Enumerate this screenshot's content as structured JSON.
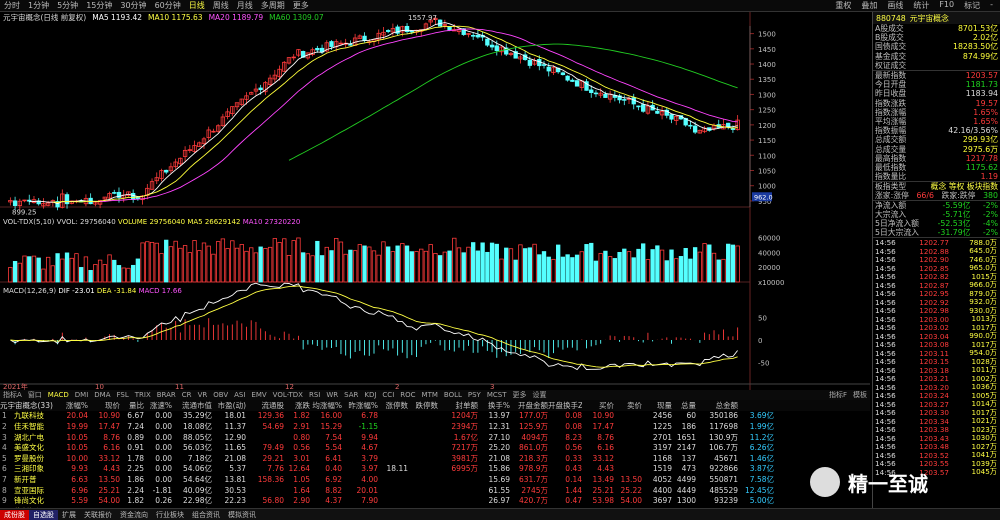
{
  "top_tabs": [
    "分时",
    "1分钟",
    "5分钟",
    "15分钟",
    "30分钟",
    "60分钟",
    "日线",
    "周线",
    "月线",
    "多周期",
    "更多"
  ],
  "top_tabs_active": 6,
  "top_right": [
    "重权",
    "叠加",
    "画线",
    "统计",
    "F10",
    "标记",
    "-"
  ],
  "title": {
    "name": "元宇宙概念(日线 前复权)",
    "ma5": "MA5 1193.42",
    "ma10": "MA10 1175.63",
    "ma20": "MA20 1189.79",
    "ma60": "MA60 1309.07"
  },
  "price_axis": [
    "1500",
    "1450",
    "1400",
    "1350",
    "1300",
    "1250",
    "1200",
    "1150",
    "1100",
    "1050",
    "1000",
    "950"
  ],
  "hi_label": "1557.97",
  "lo_label": "899.25",
  "cur_label": "962.0",
  "vol_title": {
    "name": "VOL-TDX(5,10)",
    "vvol": "VVOL: 29756040",
    "volume": "VOLUME 29756040",
    "ma5": "MA5 26629142",
    "ma10": "MA10 27320220"
  },
  "vol_axis": [
    "60000",
    "40000",
    "20000",
    "x10000"
  ],
  "macd_title": {
    "name": "MACD(12,26,9)",
    "dif": "DIF -23.01",
    "dea": "DEA -31.84",
    "macd": "MACD 17.66"
  },
  "macd_axis": [
    "50",
    "0",
    "-50"
  ],
  "date_axis": [
    "2021年",
    "10",
    "11",
    "12",
    "2",
    "3"
  ],
  "ind_tabs": [
    "指标A",
    "窗口",
    "MACD",
    "DMI",
    "DMA",
    "FSL",
    "TRIX",
    "BRAR",
    "CR",
    "VR",
    "OBV",
    "ASI",
    "EMV",
    "VOL-TDX",
    "RSI",
    "WR",
    "SAR",
    "KDJ",
    "CCI",
    "ROC",
    "MTM",
    "BOLL",
    "PSY",
    "MCST",
    "更多",
    "设置"
  ],
  "ind_active": 2,
  "ind_right": [
    "指标F",
    "模板"
  ],
  "table": {
    "title": "元宇宙概念(33)",
    "headers": [
      "",
      "涨幅%",
      "现价",
      "量比",
      "涨速%",
      "流通市值",
      "市盈(动)",
      "流通股",
      "涨跌",
      "均涨幅%",
      "昨涨幅%",
      "涨停数",
      "跌停数",
      "封单额",
      "换手%",
      "开盘金额",
      "开盘换手Z",
      "买价",
      "卖价",
      "现量",
      "总量",
      "总金额"
    ],
    "rows": [
      [
        "1",
        "九联科技",
        "20.04",
        "10.90",
        "6.67",
        "0.00",
        "35.29亿",
        "18.01",
        "129.36",
        "1.82",
        "16.00",
        "6.78",
        "",
        "",
        "1204万",
        "13.97",
        "177.0万",
        "0.08",
        "10.90",
        "",
        "2456",
        "60",
        "350186",
        "3.69亿"
      ],
      [
        "2",
        "佳禾智能",
        "19.99",
        "17.47",
        "7.24",
        "0.00",
        "18.08亿",
        "11.37",
        "54.69",
        "2.91",
        "15.29",
        "-1.15",
        "",
        "",
        "2394万",
        "12.31",
        "125.9万",
        "0.08",
        "17.47",
        "",
        "1225",
        "186",
        "117698",
        "1.99亿"
      ],
      [
        "3",
        "湖北广电",
        "10.05",
        "8.76",
        "0.89",
        "0.00",
        "88.05亿",
        "12.90",
        "",
        "0.80",
        "7.54",
        "9.94",
        "",
        "",
        "1.67亿",
        "27.10",
        "4094万",
        "8.23",
        "8.76",
        "",
        "2701",
        "1651",
        "130.9万",
        "11.2亿"
      ],
      [
        "4",
        "美盛文化",
        "10.05",
        "6.16",
        "0.91",
        "0.00",
        "56.03亿",
        "11.65",
        "79.49",
        "0.56",
        "5.54",
        "4.67",
        "",
        "",
        "7217万",
        "25.20",
        "861.0万",
        "0.56",
        "6.16",
        "",
        "3197",
        "2147",
        "106.7万",
        "6.26亿"
      ],
      [
        "5",
        "罗曼股份",
        "10.00",
        "33.12",
        "1.78",
        "0.00",
        "7.18亿",
        "21.08",
        "29.21",
        "3.01",
        "6.41",
        "3.79",
        "",
        "",
        "3981万",
        "21.08",
        "218.3万",
        "0.33",
        "33.12",
        "",
        "1168",
        "137",
        "45671",
        "1.46亿"
      ],
      [
        "6",
        "三湘印象",
        "9.93",
        "4.43",
        "2.25",
        "0.00",
        "54.06亿",
        "5.37",
        "7.76",
        "12.64",
        "0.40",
        "3.97",
        "18.11",
        "",
        "6995万",
        "15.86",
        "978.9万",
        "0.43",
        "4.43",
        "",
        "1519",
        "473",
        "922866",
        "3.87亿"
      ],
      [
        "7",
        "新开普",
        "6.63",
        "13.50",
        "1.86",
        "0.00",
        "54.64亿",
        "13.81",
        "158.36",
        "1.05",
        "6.92",
        "4.00",
        "",
        "",
        "",
        "15.69",
        "631.7万",
        "0.14",
        "13.49",
        "13.50",
        "4052",
        "4499",
        "550871",
        "7.58亿"
      ],
      [
        "8",
        "宣亚国际",
        "6.96",
        "25.21",
        "2.24",
        "-1.81",
        "40.09亿",
        "30.53",
        "",
        "1.64",
        "8.82",
        "20.01",
        "",
        "",
        "",
        "61.55",
        "2745万",
        "1.44",
        "25.21",
        "25.22",
        "4400",
        "4449",
        "485529",
        "12.45亿"
      ],
      [
        "9",
        "锋尚文化",
        "5.59",
        "54.00",
        "1.82",
        "0.26",
        "22.98亿",
        "22.23",
        "56.80",
        "2.90",
        "4.37",
        "7.90",
        "",
        "",
        "",
        "26.97",
        "420.7万",
        "0.47",
        "53.98",
        "54.00",
        "3697",
        "1300",
        "93239",
        "5.00亿"
      ],
      [
        "10",
        "佳创视讯",
        "4.70",
        "8.11",
        "1.53",
        "0.50",
        "27.38亿",
        "14.27",
        "",
        "0.37",
        "4.39",
        "2.79",
        "",
        "",
        "",
        "15.20",
        "166.9万",
        "0.07",
        "8.11",
        "8.12",
        "3679",
        "5733",
        "481675",
        "3.89亿"
      ]
    ]
  },
  "bottom_tabs": [
    "成份股",
    "自选股",
    "扩展",
    "关联报价",
    "资金流向",
    "行业板块",
    "组合资讯",
    "模拟资讯"
  ],
  "side": {
    "code": "880748",
    "name": "元宇宙概念",
    "top_kv": [
      [
        "A股成交",
        "8701.53亿"
      ],
      [
        "B股成交",
        "2.02亿"
      ],
      [
        "国债成交",
        "18283.50亿"
      ],
      [
        "基金成交",
        "874.99亿"
      ],
      [
        "权证成交",
        ""
      ]
    ],
    "mid_kv": [
      [
        "最新指数",
        "1203.57",
        "red"
      ],
      [
        "今日开盘",
        "1181.73",
        "grn"
      ],
      [
        "昨日收盘",
        "1183.94",
        "wht"
      ],
      [
        "指数涨跌",
        "19.57",
        "red"
      ],
      [
        "指数涨幅",
        "1.65%",
        "red"
      ],
      [
        "平均涨幅",
        "1.65%",
        "red"
      ],
      [
        "指数振幅",
        "42.16/3.56%",
        "wht"
      ],
      [
        "总成交额",
        "299.93亿",
        "yel"
      ],
      [
        "总成交量",
        "2975.6万",
        "yel"
      ],
      [
        "最高指数",
        "1217.78",
        "red"
      ],
      [
        "最低指数",
        "1175.62",
        "grn"
      ],
      [
        "指数量比",
        "1.19",
        "red"
      ]
    ],
    "type_row": [
      "板指类型",
      "概念 等权 板块指数"
    ],
    "updown_row": [
      "涨家:涨停",
      "66/6",
      "跌家:跌停",
      "380"
    ],
    "flow_kv": [
      [
        "净流入额",
        "-5.59亿",
        "-2%"
      ],
      [
        "大宗流入",
        "-5.71亿",
        "-2%"
      ],
      [
        "5日净流入额",
        "-52.53亿",
        "-4%"
      ],
      [
        "5日大宗流入",
        "-31.79亿",
        "-2%"
      ]
    ],
    "ticks": [
      [
        "14:56",
        "1202.77",
        "788.0万"
      ],
      [
        "14:56",
        "1202.88",
        "645.0万"
      ],
      [
        "14:56",
        "1202.90",
        "746.0万"
      ],
      [
        "14:56",
        "1202.85",
        "965.0万"
      ],
      [
        "14:56",
        "1202.82",
        "1015万"
      ],
      [
        "14:56",
        "1202.87",
        "966.0万"
      ],
      [
        "14:56",
        "1202.95",
        "879.0万"
      ],
      [
        "14:56",
        "1202.92",
        "932.0万"
      ],
      [
        "14:56",
        "1202.98",
        "930.0万"
      ],
      [
        "14:56",
        "1203.00",
        "1013万"
      ],
      [
        "14:56",
        "1203.02",
        "1017万"
      ],
      [
        "14:56",
        "1203.04",
        "990.0万"
      ],
      [
        "14:56",
        "1203.08",
        "1017万"
      ],
      [
        "14:56",
        "1203.11",
        "954.0万"
      ],
      [
        "14:56",
        "1203.15",
        "1028万"
      ],
      [
        "14:56",
        "1203.18",
        "1011万"
      ],
      [
        "14:56",
        "1203.21",
        "1002万"
      ],
      [
        "14:56",
        "1203.20",
        "1036万"
      ],
      [
        "14:56",
        "1203.24",
        "1005万"
      ],
      [
        "14:56",
        "1203.27",
        "1014万"
      ],
      [
        "14:56",
        "1203.30",
        "1017万"
      ],
      [
        "14:56",
        "1203.34",
        "1021万"
      ],
      [
        "14:56",
        "1203.38",
        "1023万"
      ],
      [
        "14:56",
        "1203.43",
        "1030万"
      ],
      [
        "14:56",
        "1203.48",
        "1027万"
      ],
      [
        "14:56",
        "1203.52",
        "1041万"
      ],
      [
        "14:56",
        "1203.55",
        "1039万"
      ],
      [
        "14:56",
        "1203.57",
        "1045万"
      ]
    ]
  },
  "watermark": "精一至诚",
  "colors": {
    "up": "#ff3b3b",
    "down": "#1fd41f",
    "ma5": "#ffffff",
    "ma10": "#ffff3a",
    "ma20": "#ff44ff",
    "ma60": "#22cc22",
    "vol_up": "#ff3b3b",
    "vol_dn": "#55ffff"
  }
}
